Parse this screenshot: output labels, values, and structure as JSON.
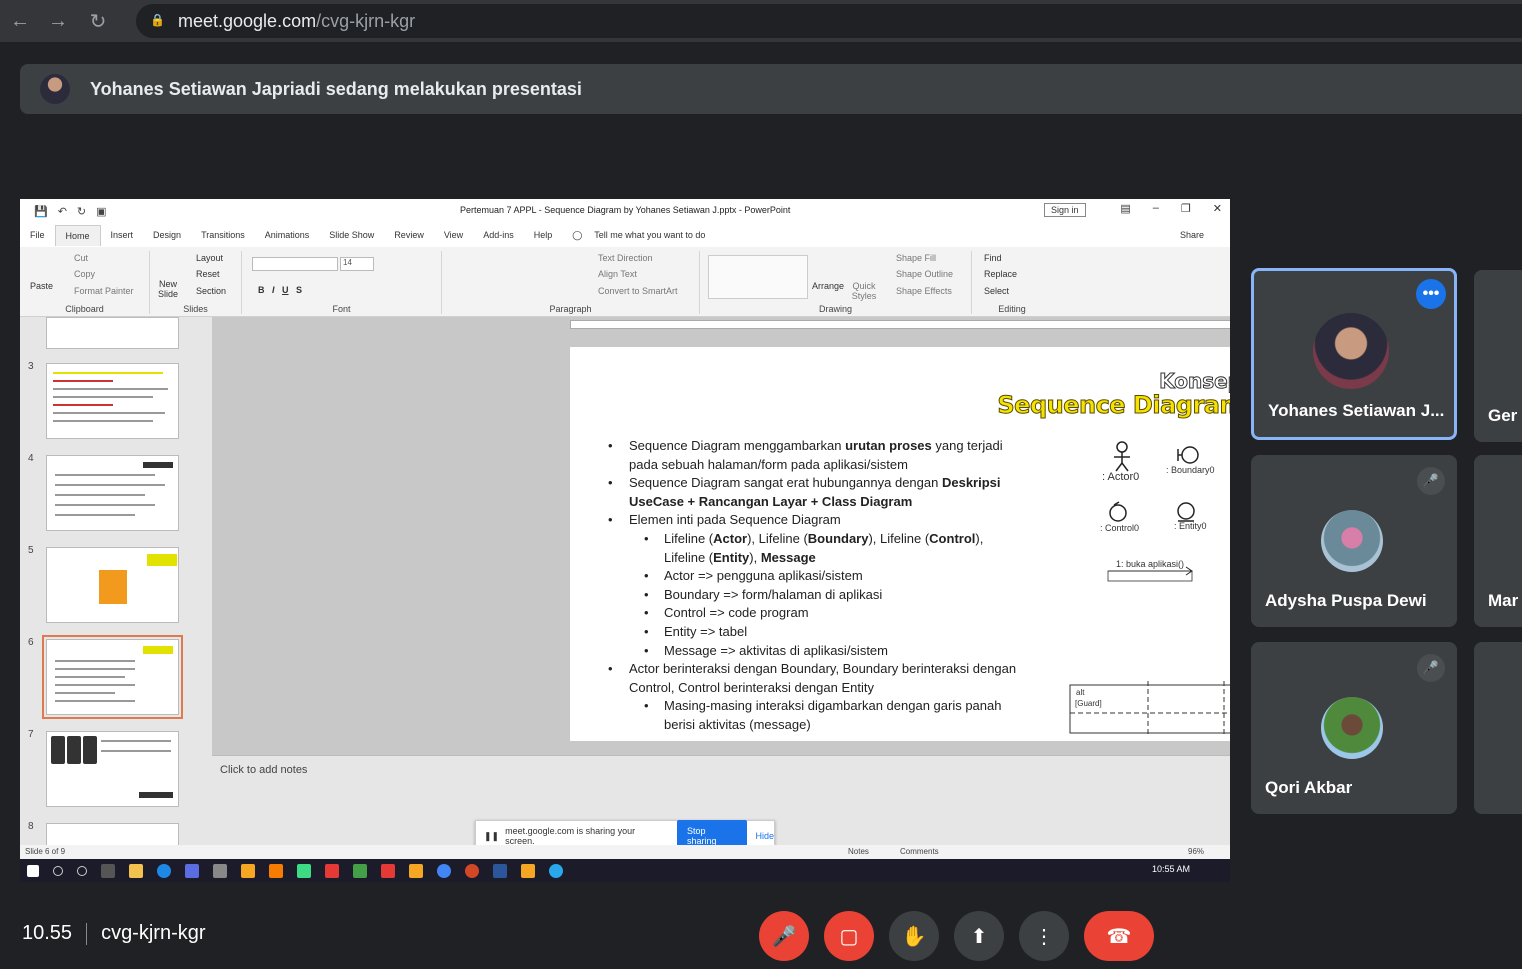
{
  "browser": {
    "url_host": "meet.google.com",
    "url_path": "/cvg-kjrn-kgr"
  },
  "presenter_banner": "Yohanes Setiawan Japriadi sedang melakukan presentasi",
  "ppt": {
    "doc_title": "Pertemuan 7 APPL - Sequence Diagram by Yohanes Setiawan J.pptx  -  PowerPoint",
    "sign_in": "Sign in",
    "tabs": [
      "File",
      "Home",
      "Insert",
      "Design",
      "Transitions",
      "Animations",
      "Slide Show",
      "Review",
      "View",
      "Add-ins",
      "Help"
    ],
    "tell_me": "Tell me what you want to do",
    "share": "Share",
    "ribbon": {
      "clipboard": "Clipboard",
      "paste": "Paste",
      "cut": "Cut",
      "copy": "Copy",
      "format_painter": "Format Painter",
      "slides": "Slides",
      "new_slide": "New Slide",
      "layout": "Layout",
      "reset": "Reset",
      "section": "Section",
      "font": "Font",
      "font_size": "14",
      "paragraph": "Paragraph",
      "text_direction": "Text Direction",
      "align_text": "Align Text",
      "convert_smartart": "Convert to SmartArt",
      "drawing": "Drawing",
      "arrange": "Arrange",
      "quick_styles": "Quick Styles",
      "shape_fill": "Shape Fill",
      "shape_outline": "Shape Outline",
      "shape_effects": "Shape Effects",
      "editing": "Editing",
      "find": "Find",
      "replace": "Replace",
      "select": "Select"
    },
    "thumb_numbers": [
      "3",
      "4",
      "5",
      "6",
      "7",
      "8"
    ],
    "slide": {
      "konsep": "Konsep",
      "title": "Sequence Diagram",
      "b1": [
        "Sequence Diagram menggambarkan ",
        "urutan proses",
        " yang terjadi pada sebuah halaman/form pada aplikasi/sistem"
      ],
      "b2": [
        "Sequence Diagram sangat erat hubungannya dengan ",
        "Deskripsi UseCase + Rancangan Layar + Class Diagram"
      ],
      "b3": "Elemen inti pada Sequence Diagram",
      "b3_1": [
        "Lifeline (",
        "Actor",
        "), Lifeline (",
        "Boundary",
        "), Lifeline (",
        "Control",
        "), Lifeline (",
        "Entity",
        "), ",
        "Message"
      ],
      "b3_2": "Actor => pengguna aplikasi/sistem",
      "b3_3": "Boundary => form/halaman di aplikasi",
      "b3_4": "Control => code program",
      "b3_5": "Entity => tabel",
      "b3_6": "Message => aktivitas di aplikasi/sistem",
      "b4": "Actor berinteraksi dengan Boundary, Boundary berinteraksi dengan Control, Control berinteraksi dengan Entity",
      "b4_1": "Masing-masing interaksi digambarkan dengan garis panah berisi aktivitas (message)",
      "uml_actor": ": Actor0",
      "uml_boundary": ": Boundary0",
      "uml_control": ": Control0",
      "uml_entity": ": Entity0",
      "uml_message": "1: buka aplikasi()",
      "uml_alt": "alt",
      "uml_guard": "[Guard]"
    },
    "notes_placeholder": "Click to add notes",
    "sharing_text": "meet.google.com is sharing your screen.",
    "stop_sharing": "Stop sharing",
    "hide": "Hide",
    "status_slide": "Slide 6 of 9",
    "status_notes": "Notes",
    "status_comments": "Comments",
    "zoom": "96%",
    "clock": "10:55 AM"
  },
  "participants": [
    {
      "name": "Yohanes Setiawan J..."
    },
    {
      "name": "Ger"
    },
    {
      "name": "Adysha Puspa Dewi"
    },
    {
      "name": "Mar"
    },
    {
      "name": "Qori Akbar"
    }
  ],
  "meeting": {
    "time": "10.55",
    "code": "cvg-kjrn-kgr"
  },
  "colors": {
    "end_call": "#ea4335",
    "accent": "#1a73e8",
    "active_tile": "#8ab4f8"
  }
}
